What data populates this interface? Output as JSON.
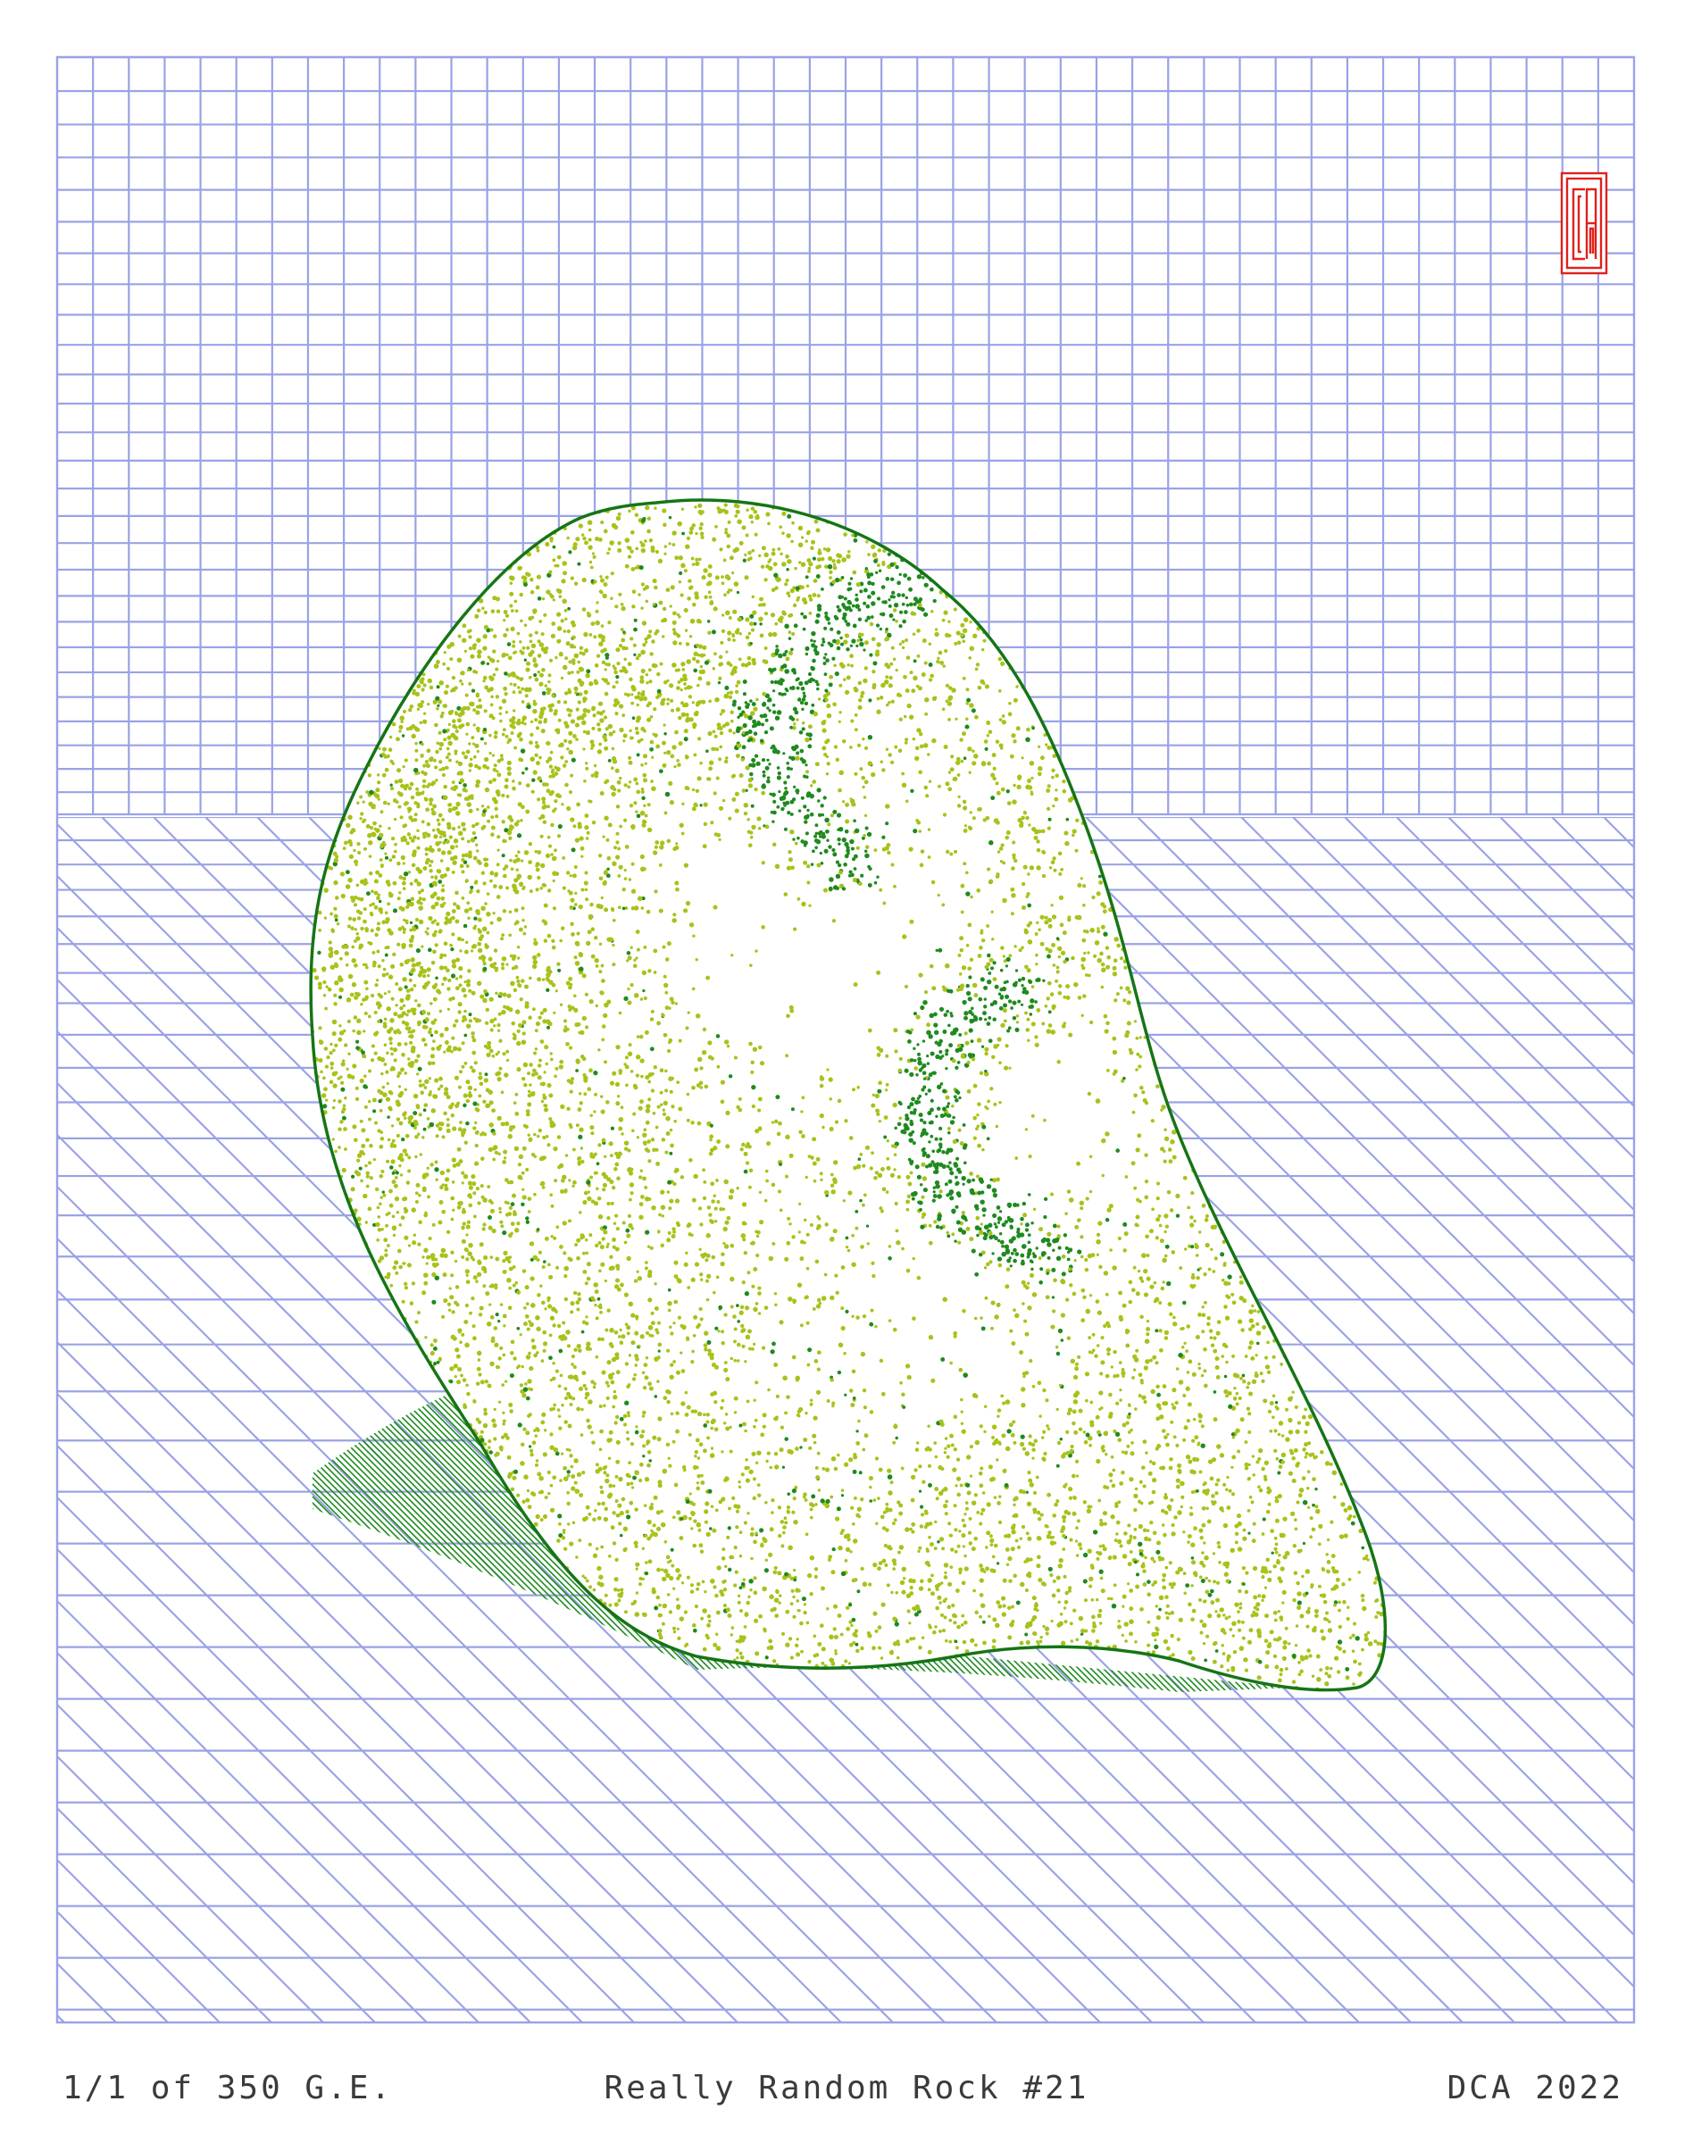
{
  "artwork": {
    "colors": {
      "grid": "#9aa2e6",
      "rock_light": "#a8c21a",
      "rock_dark": "#1f8a1f",
      "outline": "#157515",
      "shadow": "#1f8a1f",
      "seal": "#e0201c",
      "caption": "#3a3a3a"
    }
  },
  "seal": {
    "icon": "monogram-seal-icon"
  },
  "footer": {
    "edition": "1/1 of 350 G.E.",
    "title": "Really Random Rock #21",
    "signature": "DCA 2022"
  }
}
